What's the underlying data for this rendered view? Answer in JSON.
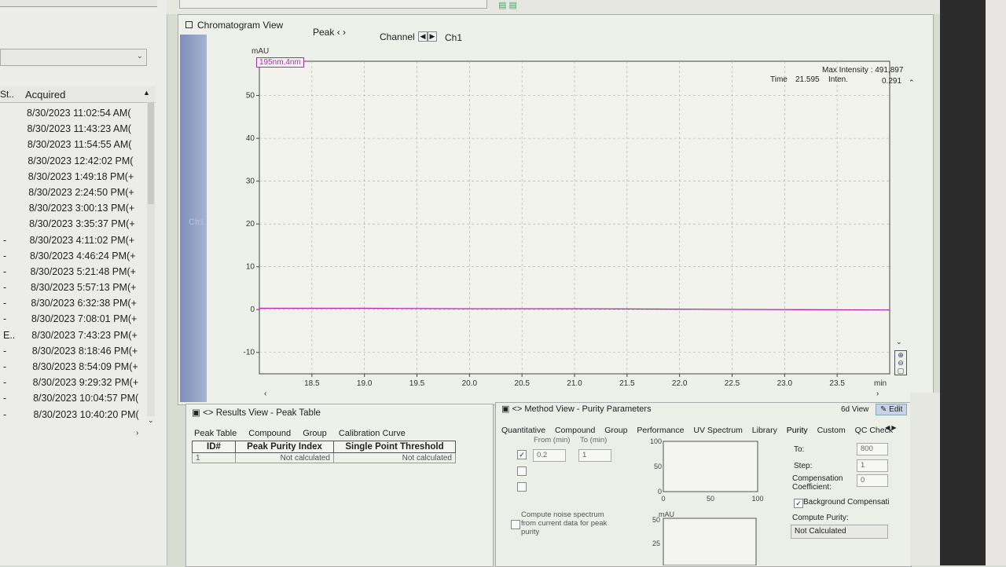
{
  "left_panel": {
    "header": {
      "status_col": "St..",
      "acquired_col": "Acquired"
    },
    "rows": [
      {
        "status": "",
        "acquired": "8/30/2023 11:02:54 AM("
      },
      {
        "status": "",
        "acquired": "8/30/2023 11:43:23 AM("
      },
      {
        "status": "",
        "acquired": "8/30/2023 11:54:55 AM("
      },
      {
        "status": "",
        "acquired": "8/30/2023 12:42:02 PM("
      },
      {
        "status": "",
        "acquired": "8/30/2023 1:49:18 PM(+"
      },
      {
        "status": "",
        "acquired": "8/30/2023 2:24:50 PM(+"
      },
      {
        "status": "",
        "acquired": "8/30/2023 3:00:13 PM(+"
      },
      {
        "status": "",
        "acquired": "8/30/2023 3:35:37 PM(+"
      },
      {
        "status": "-",
        "acquired": "8/30/2023 4:11:02 PM(+"
      },
      {
        "status": "-",
        "acquired": "8/30/2023 4:46:24 PM(+"
      },
      {
        "status": "-",
        "acquired": "8/30/2023 5:21:48 PM(+"
      },
      {
        "status": "-",
        "acquired": "8/30/2023 5:57:13 PM(+"
      },
      {
        "status": "-",
        "acquired": "8/30/2023 6:32:38 PM(+"
      },
      {
        "status": "-",
        "acquired": "8/30/2023 7:08:01 PM(+"
      },
      {
        "status": "E..",
        "acquired": "8/30/2023 7:43:23 PM(+"
      },
      {
        "status": "-",
        "acquired": "8/30/2023 8:18:46 PM(+"
      },
      {
        "status": "-",
        "acquired": "8/30/2023 8:54:09 PM(+"
      },
      {
        "status": "-",
        "acquired": "8/30/2023 9:29:32 PM(+"
      },
      {
        "status": "-",
        "acquired": "8/30/2023 10:04:57 PM("
      },
      {
        "status": "-",
        "acquired": "8/30/2023 10:40:20 PM("
      }
    ]
  },
  "chromatogram": {
    "title": "Chromatogram View",
    "peak_label": "Peak",
    "channel_label": "Channel",
    "channel_value": "Ch1",
    "side_label": "Ch1",
    "legend": "195nm,4nm",
    "max_intensity": "Max Intensity : 491,897",
    "time_label": "Time",
    "time_value": "21.595",
    "inten_label": "Inten.",
    "inten_value": "0.291",
    "y_unit": "mAU",
    "x_unit": "min"
  },
  "chart_data": {
    "type": "line",
    "title": "",
    "xlabel": "min",
    "ylabel": "mAU",
    "xlim": [
      18.0,
      24.0
    ],
    "ylim": [
      -15,
      58
    ],
    "x_ticks": [
      "18.5",
      "19.0",
      "19.5",
      "20.0",
      "20.5",
      "21.0",
      "21.5",
      "22.0",
      "22.5",
      "23.0",
      "23.5"
    ],
    "y_ticks": [
      "50",
      "40",
      "30",
      "20",
      "10",
      "0",
      "-10"
    ],
    "grid": true,
    "series": [
      {
        "name": "195nm,4nm",
        "color": "#b02ab0",
        "x": [
          18.0,
          19.0,
          20.0,
          21.0,
          22.0,
          23.0,
          24.0
        ],
        "y": [
          0.3,
          0.3,
          0.2,
          0.2,
          0.1,
          0.0,
          -0.1
        ]
      }
    ]
  },
  "results_view": {
    "title": "Results View - Peak Table",
    "tabs": [
      "Peak Table",
      "Compound",
      "Group",
      "Calibration Curve"
    ],
    "columns": [
      "ID#",
      "Peak Purity Index",
      "Single Point Threshold"
    ],
    "rows": [
      [
        "1",
        "Not calculated",
        "Not calculated"
      ]
    ]
  },
  "method_view": {
    "title": "Method View - Purity Parameters",
    "view_label": "6d View",
    "edit_label": "Edit",
    "tabs": [
      "Quantitative",
      "Compound",
      "Group",
      "Performance",
      "UV Spectrum",
      "Library",
      "Purity",
      "Custom",
      "QC Check"
    ],
    "from_label": "From (min)",
    "to_small_label": "To (min)",
    "from_value": "0.2",
    "to_small_value": "1",
    "to_label": "To:",
    "to_value": "800",
    "step_label": "Step:",
    "step_value": "1",
    "comp_label": "Compensation Coefficient:",
    "comp_value": "0",
    "bg_comp_label": "Background Compensati",
    "compute_purity_label": "Compute Purity:",
    "compute_purity_value": "Not Calculated",
    "compute_noise_label": "Compute noise spectrum from current data for peak purity",
    "mini1_y": [
      "100",
      "50",
      "0"
    ],
    "mini1_x": [
      "0",
      "50",
      "100"
    ],
    "mini2_y": [
      "50",
      "25"
    ],
    "mini2_unit": "mAU"
  }
}
